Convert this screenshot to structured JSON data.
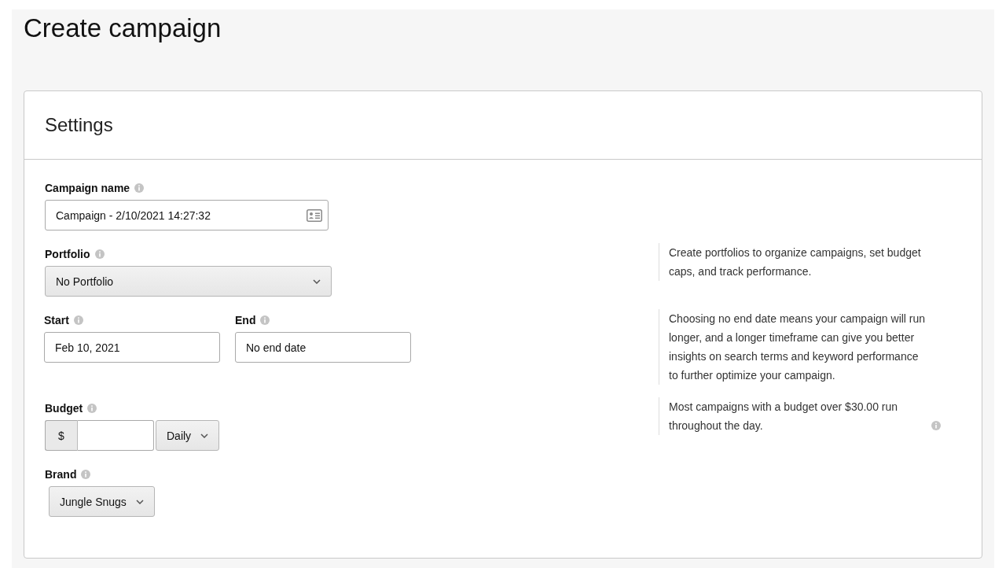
{
  "page_title": "Create campaign",
  "card_title": "Settings",
  "fields": [
    {
      "kind": "text",
      "label": "Campaign name",
      "value": "Campaign - 2/10/2021 14:27:32"
    },
    {
      "kind": "select",
      "label": "Portfolio",
      "value": "No Portfolio",
      "hint": "Create portfolios to organize campaigns, set budget caps, and track performance."
    },
    {
      "kind": "pair",
      "parts": [
        {
          "label": "Start",
          "value": "Feb 10, 2021"
        },
        {
          "label": "End",
          "value": "No end date"
        }
      ],
      "hint": "Choosing no end date means your campaign will run longer, and a longer timeframe can give you better insights on search terms and keyword performance to further optimize your campaign."
    },
    {
      "kind": "budget",
      "label": "Budget",
      "prefix": "$",
      "period": "Daily",
      "hint": "Most campaigns with a budget over $30.00 run throughout the day.",
      "hint_info": true
    },
    {
      "kind": "dropdown",
      "label": "Brand",
      "value": "Jungle Snugs"
    }
  ]
}
